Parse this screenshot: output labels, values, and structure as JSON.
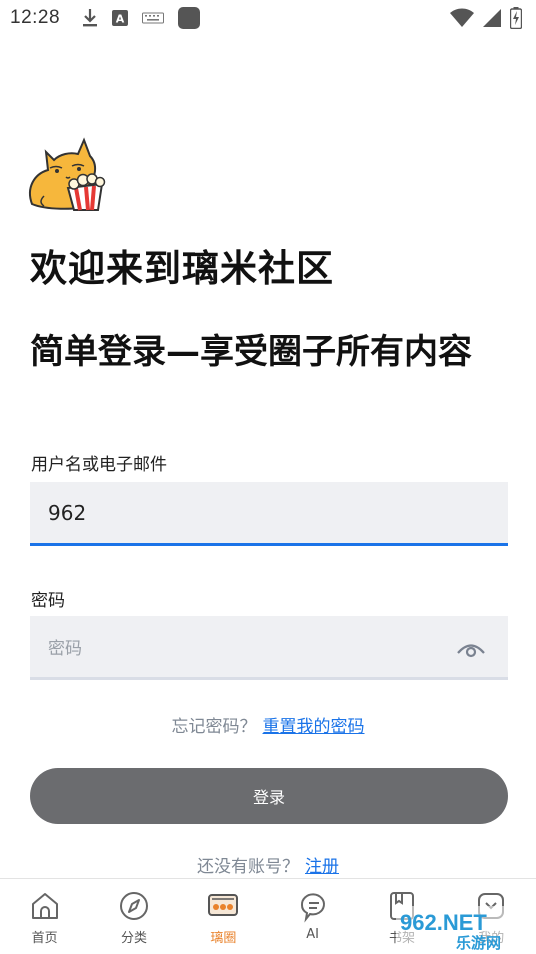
{
  "status_bar": {
    "time": "12:28"
  },
  "welcome": {
    "title": "欢迎来到璃米社区",
    "subtitle": "简单登录—享受圈子所有内容"
  },
  "form": {
    "username_label": "用户名或电子邮件",
    "username_value": "962",
    "password_label": "密码",
    "password_placeholder": "密码",
    "forgot_text": "忘记密码？",
    "reset_link": "重置我的密码",
    "login_button": "登录",
    "no_account_text": "还没有账号？",
    "register_link": "注册"
  },
  "tabs": [
    {
      "label": "首页",
      "icon": "home-icon"
    },
    {
      "label": "分类",
      "icon": "compass-icon"
    },
    {
      "label": "璃圈",
      "icon": "circle-chat-icon",
      "active": true
    },
    {
      "label": "AI",
      "icon": "ai-chat-icon"
    },
    {
      "label": "书架",
      "icon": "bookshelf-icon"
    },
    {
      "label": "我的",
      "icon": "profile-icon"
    }
  ],
  "colors": {
    "accent": "#1a73e8",
    "active_tab": "#e9822b",
    "button": "#6b6c6f",
    "input_bg": "#eff0f3"
  },
  "watermark": {
    "text_top": "962.NET",
    "text_bottom": "乐游网"
  }
}
